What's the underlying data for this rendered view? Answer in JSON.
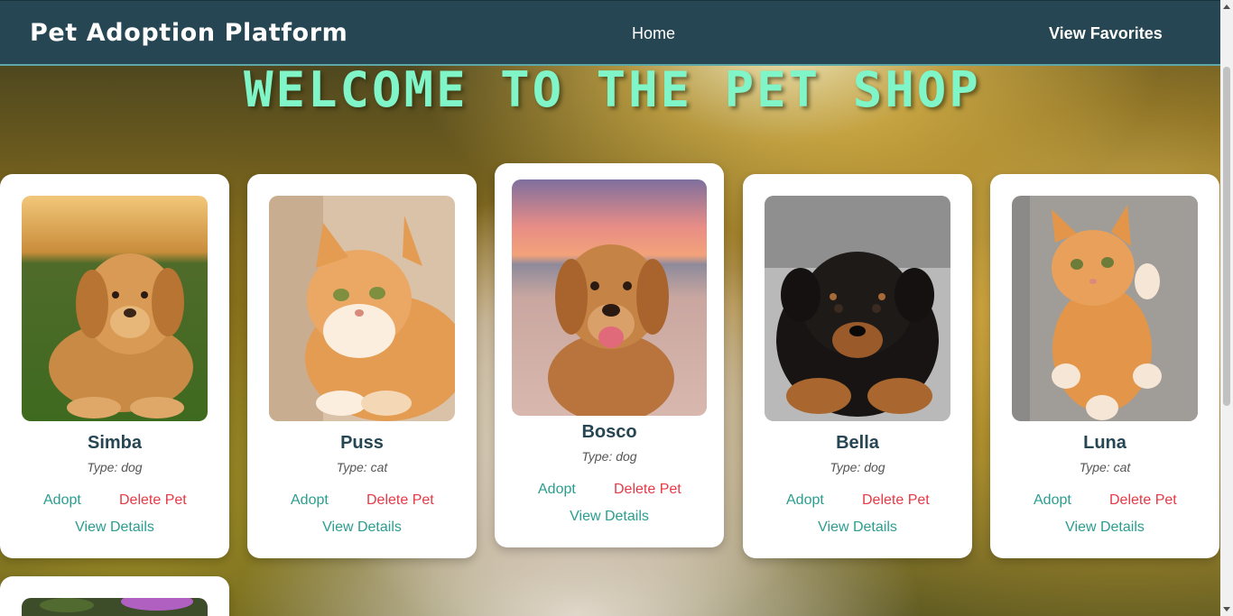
{
  "navbar": {
    "brand": "Pet Adoption Platform",
    "home_label": "Home",
    "favorites_label": "View Favorites"
  },
  "hero": {
    "title": "WELCOME TO THE PET SHOP"
  },
  "pets": [
    {
      "name": "Simba",
      "type": "Type: dog",
      "adopt": "Adopt",
      "delete": "Delete Pet",
      "details": "View Details",
      "photo": "golden-retriever-puppy-on-grass"
    },
    {
      "name": "Puss",
      "type": "Type: cat",
      "adopt": "Adopt",
      "delete": "Delete Pet",
      "details": "View Details",
      "photo": "orange-long-haired-cat"
    },
    {
      "name": "Bosco",
      "type": "Type: dog",
      "adopt": "Adopt",
      "delete": "Delete Pet",
      "details": "View Details",
      "photo": "golden-retriever-on-beach-at-sunset"
    },
    {
      "name": "Bella",
      "type": "Type: dog",
      "adopt": "Adopt",
      "delete": "Delete Pet",
      "details": "View Details",
      "photo": "rottweiler-puppy"
    },
    {
      "name": "Luna",
      "type": "Type: cat",
      "adopt": "Adopt",
      "delete": "Delete Pet",
      "details": "View Details",
      "photo": "orange-kitten-on-blanket"
    }
  ],
  "colors": {
    "navbar_bg": "#264653",
    "accent_teal": "#2a9d8f",
    "delete_red": "#e63946",
    "hero_text": "#7ff5c8"
  }
}
